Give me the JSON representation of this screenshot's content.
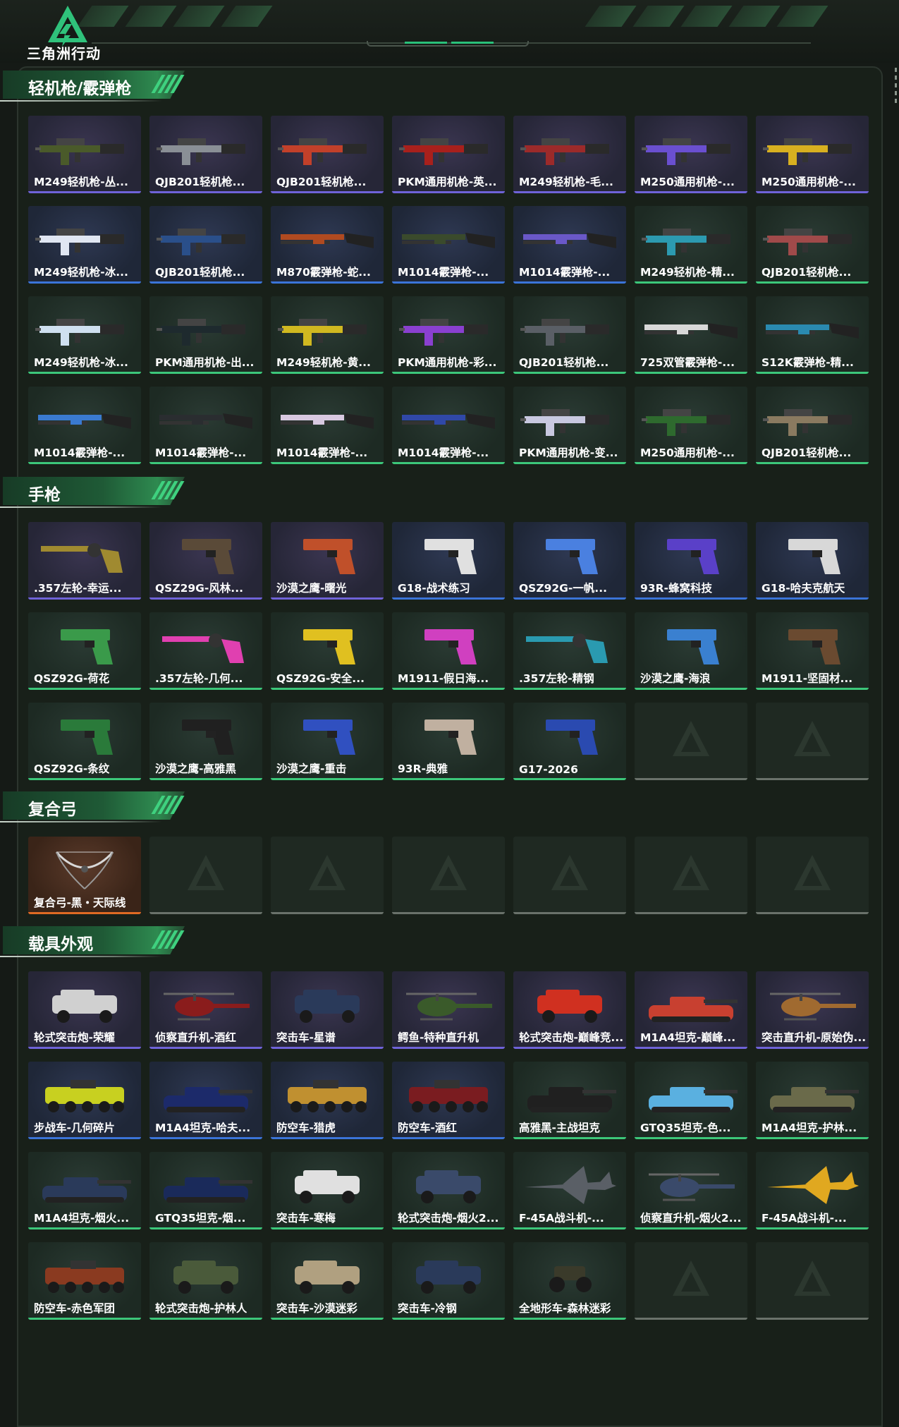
{
  "header": {
    "logo_text": "三角洲行动"
  },
  "sections": [
    {
      "title": "轻机枪/霰弹枪",
      "items": [
        {
          "label": "M249轻机枪-丛...",
          "rarity": "purple",
          "icon": "rifle-icon",
          "color": "#4a5a2a"
        },
        {
          "label": "QJB201轻机枪...",
          "rarity": "purple",
          "icon": "rifle-icon",
          "color": "#8a8f96"
        },
        {
          "label": "QJB201轻机枪...",
          "rarity": "purple",
          "icon": "rifle-icon",
          "color": "#c2402a"
        },
        {
          "label": "PKM通用机枪-英...",
          "rarity": "purple",
          "icon": "rifle-icon",
          "color": "#a8201c"
        },
        {
          "label": "M249轻机枪-毛...",
          "rarity": "purple",
          "icon": "rifle-icon",
          "color": "#9c2a2a"
        },
        {
          "label": "M250通用机枪-...",
          "rarity": "purple",
          "icon": "rifle-icon",
          "color": "#6a4fd0"
        },
        {
          "label": "M250通用机枪-...",
          "rarity": "purple",
          "icon": "rifle-icon",
          "color": "#d8b020"
        },
        {
          "label": "M249轻机枪-冰...",
          "rarity": "blue",
          "icon": "rifle-icon",
          "color": "#e0e6f2"
        },
        {
          "label": "QJB201轻机枪...",
          "rarity": "blue",
          "icon": "rifle-icon",
          "color": "#2a4f8a"
        },
        {
          "label": "M870霰弹枪-蛇...",
          "rarity": "blue",
          "icon": "shotgun-icon",
          "color": "#b04a20"
        },
        {
          "label": "M1014霰弹枪-...",
          "rarity": "blue",
          "icon": "shotgun-icon",
          "color": "#3a4a2c"
        },
        {
          "label": "M1014霰弹枪-...",
          "rarity": "blue",
          "icon": "shotgun-icon",
          "color": "#6a58c8"
        },
        {
          "label": "M249轻机枪-精...",
          "rarity": "green",
          "icon": "rifle-icon",
          "color": "#2c9ab0"
        },
        {
          "label": "QJB201轻机枪...",
          "rarity": "green",
          "icon": "rifle-icon",
          "color": "#a04a4a"
        },
        {
          "label": "M249轻机枪-冰...",
          "rarity": "green",
          "icon": "rifle-icon",
          "color": "#cfe0f0"
        },
        {
          "label": "PKM通用机枪-出...",
          "rarity": "green",
          "icon": "rifle-icon",
          "color": "#1e2a2e"
        },
        {
          "label": "M249轻机枪-黄...",
          "rarity": "green",
          "icon": "rifle-icon",
          "color": "#d0b820"
        },
        {
          "label": "PKM通用机枪-彩...",
          "rarity": "green",
          "icon": "rifle-icon",
          "color": "#8a40d0"
        },
        {
          "label": "QJB201轻机枪...",
          "rarity": "green",
          "icon": "rifle-icon",
          "color": "#5a5f66"
        },
        {
          "label": "725双管霰弹枪-...",
          "rarity": "green",
          "icon": "shotgun-icon",
          "color": "#d8d8d8"
        },
        {
          "label": "S12K霰弹枪-精...",
          "rarity": "green",
          "icon": "shotgun-icon",
          "color": "#2a8ab0"
        },
        {
          "label": "M1014霰弹枪-...",
          "rarity": "green",
          "icon": "shotgun-icon",
          "color": "#3a7ad0"
        },
        {
          "label": "M1014霰弹枪-...",
          "rarity": "green",
          "icon": "shotgun-icon",
          "color": "#2a2d30"
        },
        {
          "label": "M1014霰弹枪-...",
          "rarity": "green",
          "icon": "shotgun-icon",
          "color": "#d8c8e0"
        },
        {
          "label": "M1014霰弹枪-...",
          "rarity": "green",
          "icon": "shotgun-icon",
          "color": "#3048a8"
        },
        {
          "label": "PKM通用机枪-变...",
          "rarity": "green",
          "icon": "rifle-icon",
          "color": "#c8c8e0"
        },
        {
          "label": "M250通用机枪-...",
          "rarity": "green",
          "icon": "rifle-icon",
          "color": "#2e6a2e"
        },
        {
          "label": "QJB201轻机枪...",
          "rarity": "green",
          "icon": "rifle-icon",
          "color": "#8a7a60"
        }
      ]
    },
    {
      "title": "手枪",
      "items": [
        {
          "label": ".357左轮-幸运...",
          "rarity": "purple",
          "icon": "revolver-icon",
          "color": "#a08a30"
        },
        {
          "label": "QSZ29G-风林...",
          "rarity": "purple",
          "icon": "pistol-icon",
          "color": "#5a4a38"
        },
        {
          "label": "沙漠之鹰-曙光",
          "rarity": "purple",
          "icon": "pistol-icon",
          "color": "#c0502a"
        },
        {
          "label": "G18-战术练习",
          "rarity": "blue",
          "icon": "pistol-icon",
          "color": "#e0e0e0"
        },
        {
          "label": "QSZ92G-一帆...",
          "rarity": "blue",
          "icon": "pistol-icon",
          "color": "#4a80e0"
        },
        {
          "label": "93R-蜂窝科技",
          "rarity": "blue",
          "icon": "pistol-icon",
          "color": "#5a40c8"
        },
        {
          "label": "G18-哈夫克航天",
          "rarity": "blue",
          "icon": "pistol-icon",
          "color": "#d8d8d8"
        },
        {
          "label": "QSZ92G-荷花",
          "rarity": "green",
          "icon": "pistol-icon",
          "color": "#3a9a4a"
        },
        {
          "label": ".357左轮-几何...",
          "rarity": "green",
          "icon": "revolver-icon",
          "color": "#e040b0"
        },
        {
          "label": "QSZ92G-安全...",
          "rarity": "green",
          "icon": "pistol-icon",
          "color": "#e0c020"
        },
        {
          "label": "M1911-假日海...",
          "rarity": "green",
          "icon": "pistol-icon",
          "color": "#d040c0"
        },
        {
          "label": ".357左轮-精钢",
          "rarity": "green",
          "icon": "revolver-icon",
          "color": "#2a9ab0"
        },
        {
          "label": "沙漠之鹰-海浪",
          "rarity": "green",
          "icon": "pistol-icon",
          "color": "#3a80d0"
        },
        {
          "label": "M1911-坚固材...",
          "rarity": "green",
          "icon": "pistol-icon",
          "color": "#6a4a30"
        },
        {
          "label": "QSZ92G-条纹",
          "rarity": "green",
          "icon": "pistol-icon",
          "color": "#2a7a3a"
        },
        {
          "label": "沙漠之鹰-高雅黑",
          "rarity": "green",
          "icon": "pistol-icon",
          "color": "#202020"
        },
        {
          "label": "沙漠之鹰-重击",
          "rarity": "green",
          "icon": "pistol-icon",
          "color": "#3050c0"
        },
        {
          "label": "93R-典雅",
          "rarity": "green",
          "icon": "pistol-icon",
          "color": "#c0b0a0"
        },
        {
          "label": "G17-2026",
          "rarity": "green",
          "icon": "pistol-icon",
          "color": "#2a4ab0"
        },
        {
          "label": "",
          "rarity": "empty",
          "icon": "placeholder-icon",
          "color": "#2a342c"
        },
        {
          "label": "",
          "rarity": "empty",
          "icon": "placeholder-icon",
          "color": "#2a342c"
        }
      ]
    },
    {
      "title": "复合弓",
      "items": [
        {
          "label": "复合弓-黑・天际线",
          "rarity": "orange",
          "icon": "bow-icon",
          "color": "#d8d8d8"
        },
        {
          "label": "",
          "rarity": "empty",
          "icon": "placeholder-icon",
          "color": "#2a342c"
        },
        {
          "label": "",
          "rarity": "empty",
          "icon": "placeholder-icon",
          "color": "#2a342c"
        },
        {
          "label": "",
          "rarity": "empty",
          "icon": "placeholder-icon",
          "color": "#2a342c"
        },
        {
          "label": "",
          "rarity": "empty",
          "icon": "placeholder-icon",
          "color": "#2a342c"
        },
        {
          "label": "",
          "rarity": "empty",
          "icon": "placeholder-icon",
          "color": "#2a342c"
        },
        {
          "label": "",
          "rarity": "empty",
          "icon": "placeholder-icon",
          "color": "#2a342c"
        }
      ]
    },
    {
      "title": "载具外观",
      "items": [
        {
          "label": "轮式突击炮-荣耀",
          "rarity": "purple",
          "icon": "armored-car-icon",
          "color": "#d0d0d0"
        },
        {
          "label": "侦察直升机-酒红",
          "rarity": "purple",
          "icon": "helicopter-icon",
          "color": "#8a1c1c"
        },
        {
          "label": "突击车-星谱",
          "rarity": "purple",
          "icon": "armored-car-icon",
          "color": "#2a3a5a"
        },
        {
          "label": "鳄鱼-特种直升机",
          "rarity": "purple",
          "icon": "helicopter-icon",
          "color": "#3a5a2a"
        },
        {
          "label": "轮式突击炮-巅峰竞...",
          "rarity": "purple",
          "icon": "armored-car-icon",
          "color": "#d03020"
        },
        {
          "label": "M1A4坦克-巅峰...",
          "rarity": "purple",
          "icon": "tank-icon",
          "color": "#c84030"
        },
        {
          "label": "突击直升机-原始伪...",
          "rarity": "purple",
          "icon": "helicopter-icon",
          "color": "#a06a30"
        },
        {
          "label": "步战车-几何碎片",
          "rarity": "blue",
          "icon": "ifv-icon",
          "color": "#c8d020"
        },
        {
          "label": "M1A4坦克-哈夫...",
          "rarity": "blue",
          "icon": "tank-icon",
          "color": "#1c2a6a"
        },
        {
          "label": "防空车-猎虎",
          "rarity": "blue",
          "icon": "ifv-icon",
          "color": "#c09030"
        },
        {
          "label": "防空车-酒红",
          "rarity": "blue",
          "icon": "ifv-icon",
          "color": "#7a1c20"
        },
        {
          "label": "高雅黑-主战坦克",
          "rarity": "green",
          "icon": "tank-icon",
          "color": "#202020"
        },
        {
          "label": "GTQ35坦克-色...",
          "rarity": "green",
          "icon": "tank-icon",
          "color": "#5ab0e0"
        },
        {
          "label": "M1A4坦克-护林...",
          "rarity": "green",
          "icon": "tank-icon",
          "color": "#6a6a4a"
        },
        {
          "label": "M1A4坦克-烟火...",
          "rarity": "green",
          "icon": "tank-icon",
          "color": "#2a3a5a"
        },
        {
          "label": "GTQ35坦克-烟...",
          "rarity": "green",
          "icon": "tank-icon",
          "color": "#1a2a5a"
        },
        {
          "label": "突击车-寒梅",
          "rarity": "green",
          "icon": "armored-car-icon",
          "color": "#e0e0e0"
        },
        {
          "label": "轮式突击炮-烟火2...",
          "rarity": "green",
          "icon": "armored-car-icon",
          "color": "#3a4a6a"
        },
        {
          "label": "F-45A战斗机-...",
          "rarity": "green",
          "icon": "jet-icon",
          "color": "#5a5f66"
        },
        {
          "label": "侦察直升机-烟火2...",
          "rarity": "green",
          "icon": "helicopter-icon",
          "color": "#3a4a6a"
        },
        {
          "label": "F-45A战斗机-...",
          "rarity": "green",
          "icon": "jet-icon",
          "color": "#e0a820"
        },
        {
          "label": "防空车-赤色军团",
          "rarity": "green",
          "icon": "ifv-icon",
          "color": "#8a3a20"
        },
        {
          "label": "轮式突击炮-护林人",
          "rarity": "green",
          "icon": "armored-car-icon",
          "color": "#4a5a3a"
        },
        {
          "label": "突击车-沙漠迷彩",
          "rarity": "green",
          "icon": "armored-car-icon",
          "color": "#b0a080"
        },
        {
          "label": "突击车-冷钢",
          "rarity": "green",
          "icon": "armored-car-icon",
          "color": "#2a3a5a"
        },
        {
          "label": "全地形车-森林迷彩",
          "rarity": "green",
          "icon": "atv-icon",
          "color": "#3a3a2a"
        },
        {
          "label": "",
          "rarity": "empty",
          "icon": "placeholder-icon",
          "color": "#2a342c"
        },
        {
          "label": "",
          "rarity": "empty",
          "icon": "placeholder-icon",
          "color": "#2a342c"
        }
      ]
    }
  ]
}
